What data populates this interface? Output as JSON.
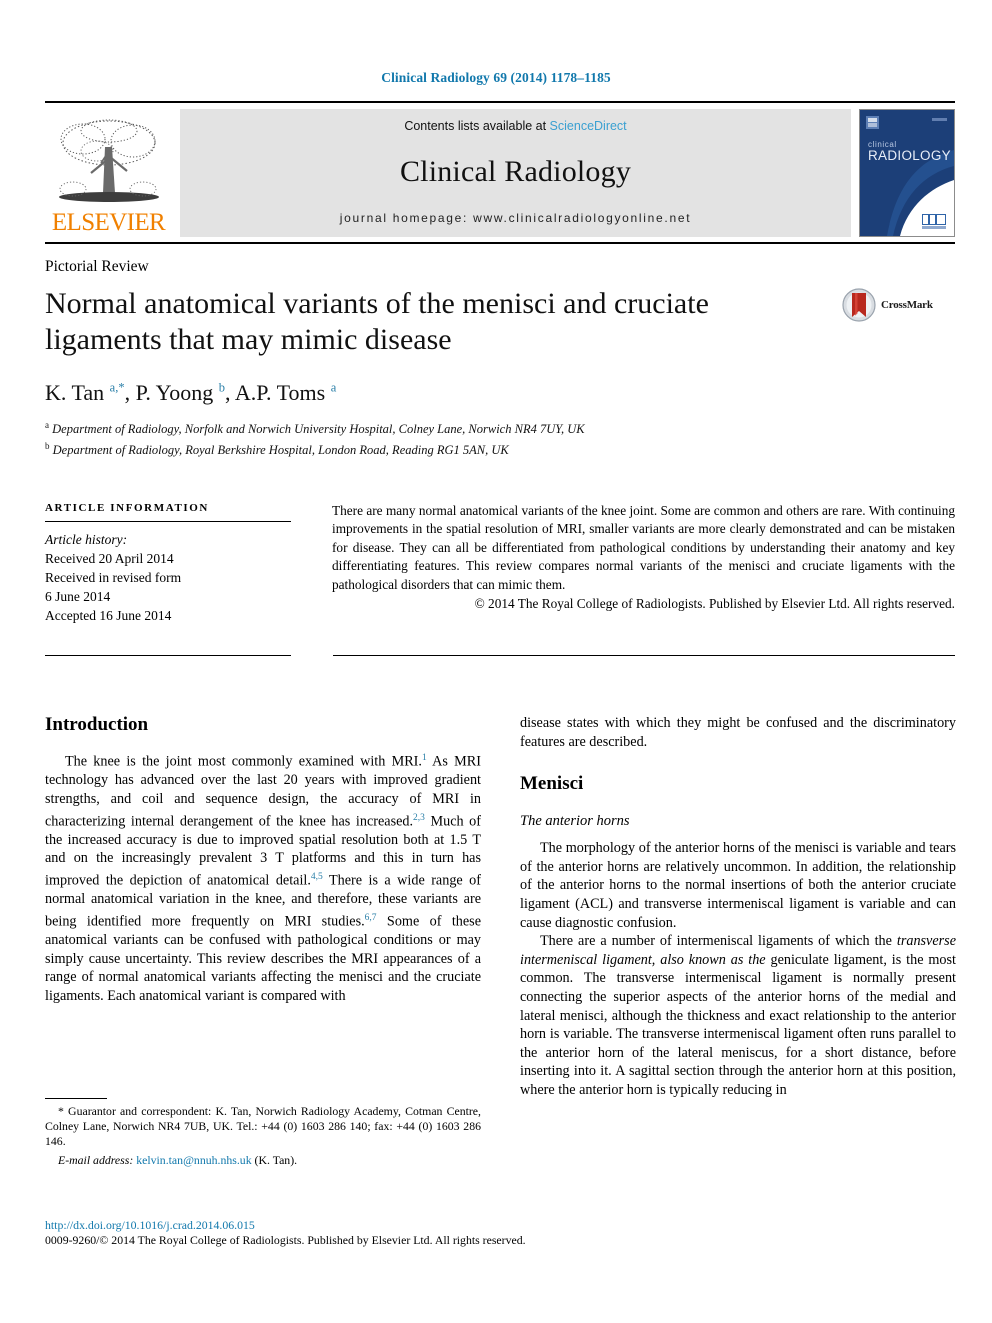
{
  "running_head": "Clinical Radiology 69 (2014) 1178–1185",
  "masthead": {
    "publisher_name": "ELSEVIER",
    "contents_prefix": "Contents lists available at ",
    "contents_link": "ScienceDirect",
    "journal_name": "Clinical Radiology",
    "homepage_line": "journal homepage: www.clinicalradiologyonline.net",
    "cover_title_small": "clinical",
    "cover_title_large": "RADIOLOGY"
  },
  "article": {
    "type": "Pictorial Review",
    "title": "Normal anatomical variants of the menisci and cruciate ligaments that may mimic disease",
    "crossmark_label": "CrossMark",
    "authors_html": "K. Tan <sup>a</sup><sup>,</sup><sup>*</sup>, P. Yoong <sup>b</sup>, A.P. Toms <sup>a</sup>",
    "affiliation_a": "Department of Radiology, Norfolk and Norwich University Hospital, Colney Lane, Norwich NR4 7UY, UK",
    "affiliation_b": "Department of Radiology, Royal Berkshire Hospital, London Road, Reading RG1 5AN, UK"
  },
  "article_information": {
    "heading": "ARTICLE INFORMATION",
    "history_label": "Article history:",
    "history": [
      "Received 20 April 2014",
      "Received in revised form",
      "6 June 2014",
      "Accepted 16 June 2014"
    ]
  },
  "abstract": {
    "text": "There are many normal anatomical variants of the knee joint. Some are common and others are rare. With continuing improvements in the spatial resolution of MRI, smaller variants are more clearly demonstrated and can be mistaken for disease. They can all be differentiated from pathological conditions by understanding their anatomy and key differentiating features. This review compares normal variants of the menisci and cruciate ligaments with the pathological disorders that can mimic them.",
    "copyright": "© 2014 The Royal College of Radiologists. Published by Elsevier Ltd. All rights reserved."
  },
  "body": {
    "introduction_heading": "Introduction",
    "intro_p1_part1": "The knee is the joint most commonly examined with MRI.",
    "intro_p1_ref1": "1",
    "intro_p1_part2": " As MRI technology has advanced over the last 20 years with improved gradient strengths, and coil and sequence design, the accuracy of MRI in characterizing internal derangement of the knee has increased.",
    "intro_p1_ref2": "2,3",
    "intro_p1_part3": " Much of the increased accuracy is due to improved spatial resolution both at 1.5 T and on the increasingly prevalent 3 T platforms and this in turn has improved the depiction of anatomical detail.",
    "intro_p1_ref3": "4,5",
    "intro_p1_part4": " There is a wide range of normal anatomical variation in the knee, and therefore, these variants are being identified more frequently on MRI studies.",
    "intro_p1_ref4": "6,7",
    "intro_p1_part5": " Some of these anatomical variants can be confused with pathological conditions or may simply cause uncertainty. This review describes the MRI appearances of a range of normal anatomical variants affecting the menisci and the cruciate ligaments. Each anatomical variant is compared with",
    "intro_continued": "disease states with which they might be confused and the discriminatory features are described.",
    "menisci_heading": "Menisci",
    "anterior_horns_subheading": "The anterior horns",
    "anterior_horns_p1": "The morphology of the anterior horns of the menisci is variable and tears of the anterior horns are relatively uncommon. In addition, the relationship of the anterior horns to the normal insertions of both the anterior cruciate ligament (ACL) and transverse intermeniscal ligament is variable and can cause diagnostic confusion.",
    "anterior_horns_p2_part1": "There are a number of intermeniscal ligaments of which the ",
    "anterior_horns_p2_italic": "transverse intermeniscal ligament, also known as the",
    "anterior_horns_p2_part2": " geniculate ligament, is the most common. The transverse intermeniscal ligament is normally present connecting the superior aspects of the anterior horns of the medial and lateral menisci, although the thickness and exact relationship to the anterior horn is variable. The transverse intermeniscal ligament often runs parallel to the anterior horn of the lateral meniscus, for a short distance, before inserting into it. A sagittal section through the anterior horn at this position, where the anterior horn is typically reducing in"
  },
  "footnote": {
    "correspondence": "* Guarantor and correspondent: K. Tan, Norwich Radiology Academy, Cotman Centre, Colney Lane, Norwich NR4 7UB, UK. Tel.: +44 (0) 1603 286 140; fax: +44 (0) 1603 286 146.",
    "email_label": "E-mail address:",
    "email_address": "kelvin.tan@nnuh.nhs.uk",
    "email_suffix": " (K. Tan)."
  },
  "footer": {
    "doi": "http://dx.doi.org/10.1016/j.crad.2014.06.015",
    "issn_line": "0009-9260/© 2014 The Royal College of Radiologists. Published by Elsevier Ltd. All rights reserved."
  },
  "colors": {
    "link_blue": "#1178ac",
    "sciencedirect_blue": "#3aa0d1",
    "elsevier_orange": "#f08000",
    "ref_blue": "#2a7fa8",
    "cover_navy": "#1c3f78",
    "crossmark_red": "#b8281e"
  }
}
